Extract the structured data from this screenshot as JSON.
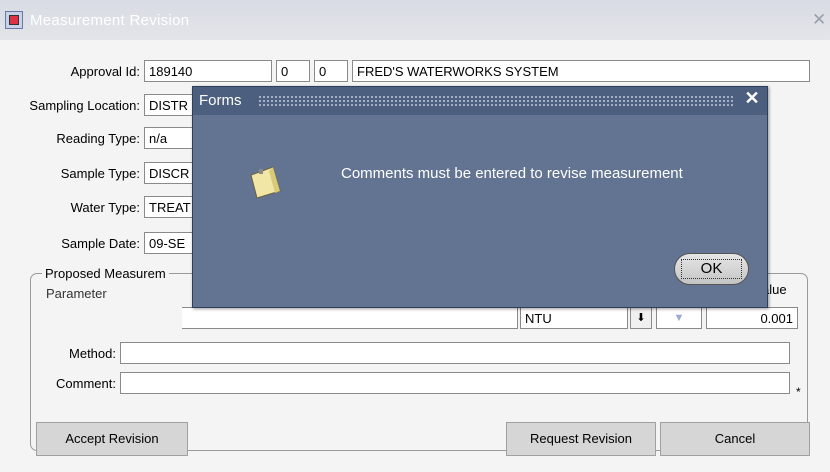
{
  "window": {
    "title": "Measurement Revision",
    "close_glyph": "✕"
  },
  "form": {
    "approval_id_label": "Approval Id:",
    "approval_id": "189140",
    "approval_code1": "0",
    "approval_code2": "0",
    "approval_name": "FRED'S WATERWORKS SYSTEM",
    "sampling_location_label": "Sampling Location:",
    "sampling_location": "DISTR",
    "reading_type_label": "Reading Type:",
    "reading_type": "n/a",
    "sample_type_label": "Sample Type:",
    "sample_type": "DISCR",
    "water_type_label": "Water Type:",
    "water_type": "TREAT",
    "sample_date_label": "Sample Date:",
    "sample_date": "09-SE"
  },
  "proposed": {
    "group_title": "Proposed Measurem",
    "parameter_label": "Parameter",
    "value_label": "alue",
    "unit": "NTU",
    "value": "0.001",
    "method_label": "Method:",
    "method": "",
    "comment_label": "Comment:",
    "comment": "",
    "required_marker": "*"
  },
  "buttons": {
    "accept": "Accept Revision",
    "request": "Request Revision",
    "cancel": "Cancel"
  },
  "dialog": {
    "title": "Forms",
    "message": "Comments must be entered to revise measurement",
    "ok": "OK",
    "close_glyph": "✕"
  },
  "icons": {
    "app": "oracle-forms-app-icon",
    "note": "note-paper-icon",
    "dropdown": "dropdown-arrow-icon"
  }
}
